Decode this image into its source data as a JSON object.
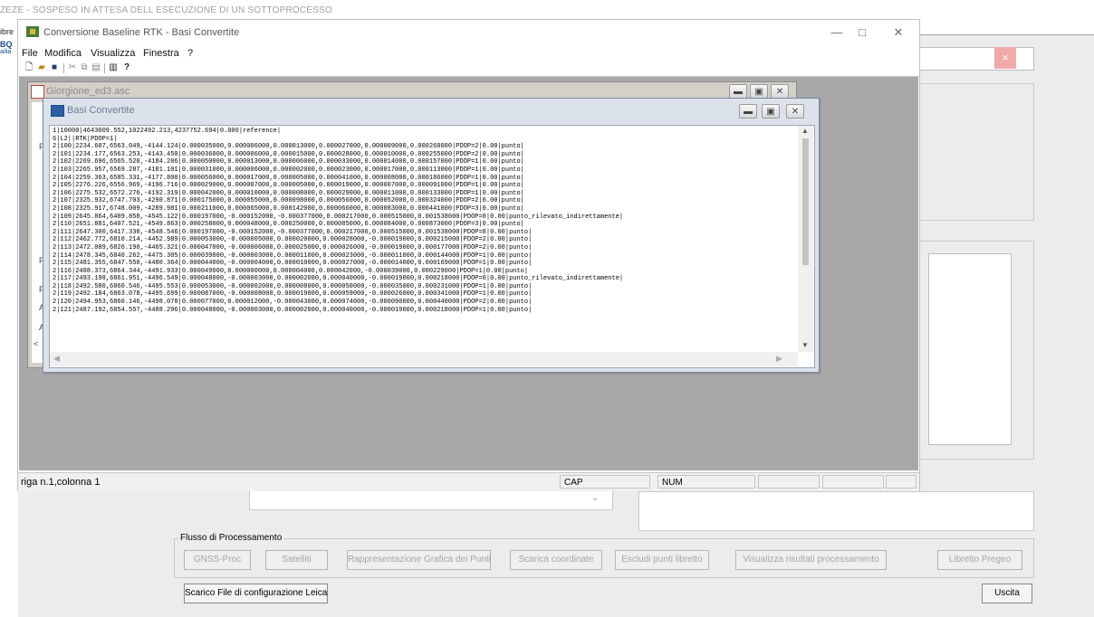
{
  "background": {
    "title_fragment": "ZEZE - SOSPESO IN ATTESA DELL ESECUZIONE DI UN SOTTOPROCESSO",
    "left_labels": [
      "ibre",
      "BQ",
      "ailia"
    ],
    "close_glyph": "×",
    "combo_arrow": "⌄",
    "group_title": "Flusso di Processamento",
    "group_buttons": [
      "GNSS-Proc",
      "Satelliti",
      "Rappresentazione Grafica dei Punti",
      "Scarica coordinate",
      "Escludi punti libretto",
      "Visualizza risultati processamento",
      "Libretto Pregeo"
    ],
    "scarico_label": "Scarico File di configurazione Leica",
    "uscita_label": "Uscita"
  },
  "main_window": {
    "title": "Conversione Baseline RTK - Basi Convertite",
    "controls": {
      "minimize": "—",
      "maximize": "□",
      "close": "✕"
    },
    "menu": [
      "File",
      "Modifica",
      "Visualizza",
      "Finestra",
      "?"
    ],
    "status": {
      "text": "riga n.1,colonna 1",
      "caps": "CAP",
      "num": "NUM"
    }
  },
  "window_giorgione": {
    "title": "Giorgione_ed3.asc",
    "side_labels": [
      "PF",
      "PF",
      "PF",
      "A",
      "A",
      "<"
    ]
  },
  "window_basi": {
    "title": "Basi Convertite",
    "lines": [
      "1|10000|4643009.552,1022492.213,4237752.694|0.000|reference|",
      "6|L2||RTK|PDOP=1|",
      "2|100|2234.607,6563.049,-4144.124|0.000035000,0.000006000,0.000013000,0.000027000,0.000009000,0.000268000|PDOP=2|0.00|punto|",
      "2|101|2234.177,6563.253,-4143.450|0.000036000,0.000006000,0.000015000,0.000028000,0.000010000,0.000255000|PDOP=2|0.00|punto|",
      "2|102|2269.696,6565.520,-4184.286|0.000050000,0.000013000,0.000006000,0.000033000,0.000014000,0.000157000|PDOP=1|0.00|punto|",
      "2|103|2265.957,6569.287,-4181.101|0.000031000,0.000006000,0.000002000,0.000023000,0.000017000,0.000113000|PDOP=1|0.00|punto|",
      "2|104|2259.363,6585.331,-4177.800|0.000056000,0.000017000,0.000005000,0.000041000,0.000008000,0.000186000|PDOP=1|0.00|punto|",
      "2|105|2276.226,6556.969,-4196.716|0.000029000,0.000007000,0.000005000,0.000019000,0.000007000,0.000091000|PDOP=1|0.00|punto|",
      "2|106|2275.532,6572.276,-4192.319|0.000042000,0.000010000,0.000008000,0.000029000,0.000011000,0.000133000|PDOP=1|0.00|punto|",
      "2|107|2325.932,6747.703,-4290.871|0.000175000,0.000055000,0.000098000,0.000056000,0.000052000,0.000324000|PDOP=2|0.00|punto|",
      "2|108|2325.917,6748.009,-4289.981|0.000211000,0.000065000,0.000142000,0.000066000,0.000083000,0.000441000|PDOP=3|0.00|punto|",
      "2|109|2645.864,6409.858,-4545.122|0.000197000,-0.000152000,-0.000377000,0.000217000,0.000515000,0.001538000|PDOP=0|0.00|punto_rilevato_indirettamente|",
      "2|110|2651.881,6407.521,-4549.863|0.000258000,0.000048000,0.000250000,0.000085000,0.000084000,0.000873000|PDOP=3|0.00|punto|",
      "2|111|2647.300,6417.330,-4548.546|0.000197000,-0.000152000,-0.000377000,0.000217000,0.000515000,0.001538000|PDOP=8|0.00|punto|",
      "2|112|2462.772,6810.214,-4452.989|0.000053000,-0.000005000,0.000020000,0.000028000,-0.000019000,0.000215000|PDOP=2|0.00|punto|",
      "2|113|2472.089,6826.190,-4465.321|0.000047000,-0.000006000,0.000025000,0.000026000,-0.000019000,0.000177000|PDOP=2|0.00|punto|",
      "2|114|2478.345,6840.262,-4475.305|0.000039000,-0.000003000,0.000011000,0.000023000,-0.000011000,0.000144000|PDOP=1|0.00|punto|",
      "2|115|2481.355,6847.550,-4480.364|0.000044000,-0.000004000,0.000010000,0.000027000,-0.000014000,0.000169000|PDOP=1|0.00|punto|",
      "2|116|2488.373,6864.344,-4491.933|0.000049000,0.000000000,0.000004000,0.000042000,-0.000039000,0.000229000|PDOP=1|0.00|punto|",
      "2|117|2493.198,6861.951,-4496.549|0.000048000,-0.000003000,0.000002000,0.000040000,-0.000019000,0.000218000|PDOP=0|0.00|punto_rilevato_indirettamente|",
      "2|118|2492.580,6860.546,-4495.553|0.000053000,-0.000002000,0.000008000,0.000050000,-0.000035000,0.000231000|PDOP=1|0.00|punto|",
      "2|119|2492.184,6863.078,-4495.699|0.000087000,-0.000008000,0.000019000,0.000059000,-0.000026000,0.000341000|PDOP=1|0.00|punto|",
      "2|120|2494.953,6860.146,-4498.078|0.000077000,0.000012000,-0.000043000,0.000074000,-0.000090000,0.000440000|PDOP=2|0.00|punto|",
      "2|121|2487.192,6854.557,-4488.296|0.000048000,-0.000003000,0.000002000,0.000040000,-0.000019000,0.000218000|PDOP=1|0.00|punto|"
    ]
  }
}
